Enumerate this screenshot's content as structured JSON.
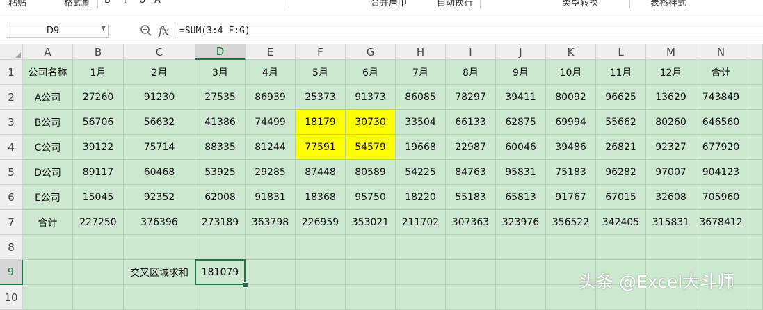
{
  "toolbar": {
    "items": [
      "粘贴",
      "格式刷",
      "B",
      "I",
      "U",
      "A",
      "合并居中",
      "自动换行",
      "类型转换",
      "表格样式"
    ]
  },
  "formula_bar": {
    "name_box": "D9",
    "fx_label": "fx",
    "formula": "=SUM(3:4 F:G)"
  },
  "sheet": {
    "columns": [
      "A",
      "B",
      "C",
      "D",
      "E",
      "F",
      "G",
      "H",
      "I",
      "J",
      "K",
      "L",
      "M",
      "N"
    ],
    "rows": [
      "1",
      "2",
      "3",
      "4",
      "5",
      "6",
      "7",
      "8",
      "9",
      "10"
    ],
    "selected_col": "D",
    "selected_row": "9",
    "cells": [
      [
        "公司名称",
        "1月",
        "2月",
        "3月",
        "4月",
        "5月",
        "6月",
        "7月",
        "8月",
        "9月",
        "10月",
        "11月",
        "12月",
        "合计"
      ],
      [
        "A公司",
        "27260",
        "91230",
        "27535",
        "86939",
        "25373",
        "91373",
        "86085",
        "78297",
        "39411",
        "80092",
        "96625",
        "13629",
        "743849"
      ],
      [
        "B公司",
        "56706",
        "56632",
        "41386",
        "74499",
        "18179",
        "30730",
        "33504",
        "66133",
        "62875",
        "69994",
        "55662",
        "80260",
        "646560"
      ],
      [
        "C公司",
        "39122",
        "75714",
        "88335",
        "81244",
        "77591",
        "54579",
        "19668",
        "22987",
        "60046",
        "39486",
        "26821",
        "92327",
        "677920"
      ],
      [
        "D公司",
        "89117",
        "60468",
        "53925",
        "29285",
        "87448",
        "80589",
        "54225",
        "84763",
        "95831",
        "75183",
        "96282",
        "97007",
        "904123"
      ],
      [
        "E公司",
        "15045",
        "92352",
        "62008",
        "91831",
        "18368",
        "95750",
        "18220",
        "55183",
        "65813",
        "91767",
        "67015",
        "32608",
        "705960"
      ],
      [
        "合计",
        "227250",
        "376396",
        "273189",
        "363798",
        "226959",
        "353021",
        "211702",
        "307363",
        "323976",
        "356522",
        "342405",
        "315831",
        "3678412"
      ],
      [
        "",
        "",
        "",
        "",
        "",
        "",
        "",
        "",
        "",
        "",
        "",
        "",
        "",
        ""
      ],
      [
        "",
        "",
        "交叉区域求和",
        "181079",
        "",
        "",
        "",
        "",
        "",
        "",
        "",
        "",
        "",
        ""
      ],
      [
        "",
        "",
        "",
        "",
        "",
        "",
        "",
        "",
        "",
        "",
        "",
        "",
        "",
        ""
      ]
    ],
    "highlight_color": "#ffff00",
    "cell_bg_color": "#cce8cf",
    "selection_color": "#217346"
  },
  "watermark": "头条 @Excel大斗师"
}
